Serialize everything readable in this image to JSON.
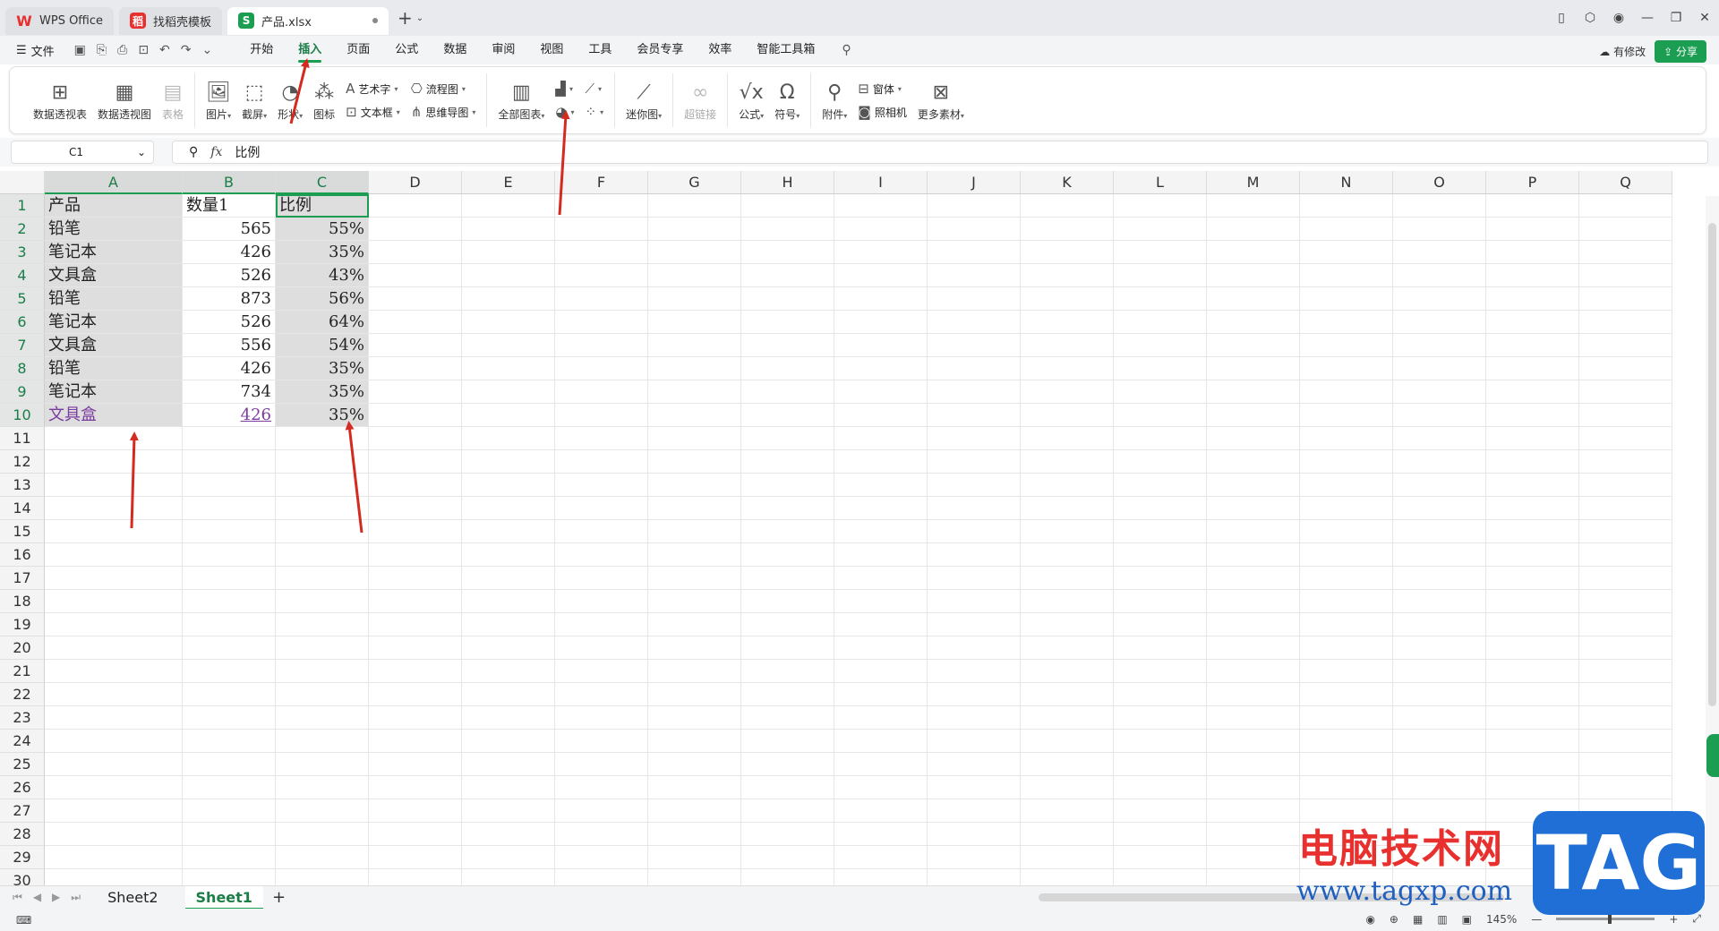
{
  "titlebar": {
    "tabs": [
      {
        "label": "WPS Office",
        "logo": "W"
      },
      {
        "label": "找稻壳模板",
        "logo": "稻"
      },
      {
        "label": "产品.xlsx",
        "logo": "S"
      }
    ]
  },
  "menubar": {
    "file_label": "文件",
    "menus": [
      "开始",
      "插入",
      "页面",
      "公式",
      "数据",
      "审阅",
      "视图",
      "工具",
      "会员专享",
      "效率",
      "智能工具箱"
    ],
    "active_menu": "插入",
    "modified_label": "有修改",
    "share_label": "分享"
  },
  "ribbon": {
    "pivot_table": "数据透视表",
    "pivot_chart": "数据透视图",
    "table": "表格",
    "picture": "图片",
    "screenshot": "截屏",
    "shape": "形状",
    "icon": "图标",
    "art_text": "艺术字",
    "text_box": "文本框",
    "flowchart": "流程图",
    "mind_map": "思维导图",
    "all_charts": "全部图表",
    "sparkline": "迷你图",
    "hyperlink": "超链接",
    "formula": "公式",
    "symbol": "符号",
    "attachment": "附件",
    "form": "窗体",
    "camera": "照相机",
    "more_material": "更多素材"
  },
  "formula_bar": {
    "cell_ref": "C1",
    "content": "比例"
  },
  "grid": {
    "columns": [
      "A",
      "B",
      "C",
      "D",
      "E",
      "F",
      "G",
      "H",
      "I",
      "J",
      "K",
      "L",
      "M",
      "N",
      "O",
      "P",
      "Q"
    ],
    "rows": [
      "1",
      "2",
      "3",
      "4",
      "5",
      "6",
      "7",
      "8",
      "9",
      "10",
      "11",
      "12",
      "13",
      "14",
      "15",
      "16",
      "17",
      "18",
      "19",
      "20",
      "21",
      "22",
      "23",
      "24",
      "25",
      "26",
      "27",
      "28",
      "29",
      "30"
    ],
    "data": [
      [
        "产品",
        "数量1",
        "比例"
      ],
      [
        "铅笔",
        "565",
        "55%"
      ],
      [
        "笔记本",
        "426",
        "35%"
      ],
      [
        "文具盒",
        "526",
        "43%"
      ],
      [
        "铅笔",
        "873",
        "56%"
      ],
      [
        "笔记本",
        "526",
        "64%"
      ],
      [
        "文具盒",
        "556",
        "54%"
      ],
      [
        "铅笔",
        "426",
        "35%"
      ],
      [
        "笔记本",
        "734",
        "35%"
      ],
      [
        "文具盒",
        "426",
        "35%"
      ]
    ]
  },
  "sheets": {
    "tabs": [
      "Sheet2",
      "Sheet1"
    ],
    "active": "Sheet1"
  },
  "status": {
    "zoom": "145%"
  },
  "watermark": {
    "cn": "电脑技术网",
    "url": "www.tagxp.com",
    "tag": "TAG"
  }
}
